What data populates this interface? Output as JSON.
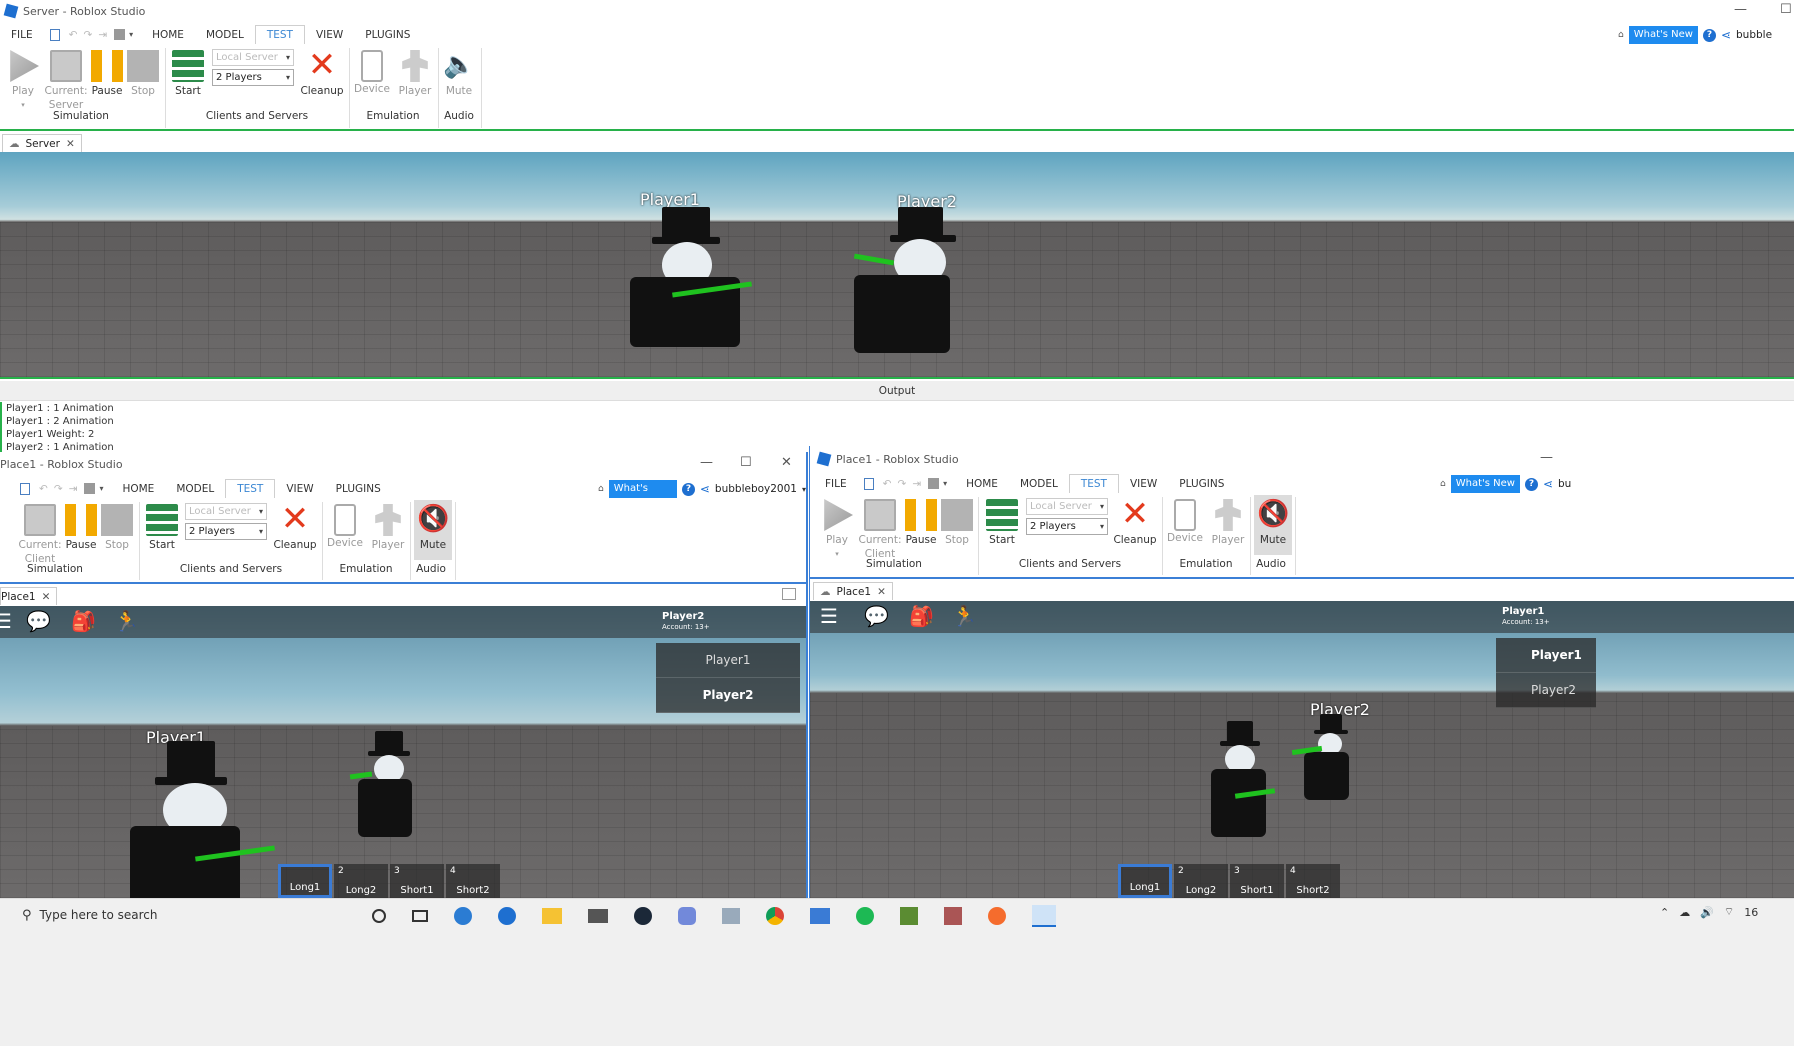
{
  "server": {
    "title": "Server - Roblox Studio",
    "menu": [
      "FILE",
      "HOME",
      "MODEL",
      "TEST",
      "VIEW",
      "PLUGINS"
    ],
    "whats_new": "What's New",
    "user": "bubble",
    "tools": {
      "play": "Play",
      "current": "Current:\nServer",
      "pause": "Pause",
      "stop": "Stop",
      "start": "Start",
      "local_server": "Local Server",
      "players": "2 Players",
      "cleanup": "Cleanup",
      "device": "Device",
      "player": "Player",
      "mute": "Mute"
    },
    "groups": {
      "simulation": "Simulation",
      "clients": "Clients and Servers",
      "emulation": "Emulation",
      "audio": "Audio"
    },
    "doc_tab": "Server",
    "tag1": "Player1",
    "tag2": "Player2"
  },
  "output": {
    "title": "Output",
    "lines": [
      "Player1 : 1 Animation",
      "Player1 : 2 Animation",
      "Player1 Weight: 2",
      "Player2 : 1 Animation"
    ]
  },
  "place_left": {
    "title": "Place1 - Roblox Studio",
    "menu": [
      "HOME",
      "MODEL",
      "TEST",
      "VIEW",
      "PLUGINS"
    ],
    "whats_new": "What's New",
    "user": "bubbleboy2001",
    "tools": {
      "current": "Current:\nClient",
      "pause": "Pause",
      "stop": "Stop",
      "start": "Start",
      "local_server": "Local Server",
      "players": "2 Players",
      "cleanup": "Cleanup",
      "device": "Device",
      "player": "Player",
      "mute": "Mute"
    },
    "groups": {
      "simulation": "Simulation",
      "clients": "Clients and Servers",
      "emulation": "Emulation",
      "audio": "Audio"
    },
    "doc_tab": "Place1",
    "hud_name": "Player2",
    "hud_account": "Account: 13+",
    "list": [
      "Player1",
      "Player2"
    ],
    "tag": "Player1",
    "slots": [
      {
        "n": "",
        "l": "Long1"
      },
      {
        "n": "2",
        "l": "Long2"
      },
      {
        "n": "3",
        "l": "Short1"
      },
      {
        "n": "4",
        "l": "Short2"
      }
    ]
  },
  "place_right": {
    "title": "Place1 - Roblox Studio",
    "menu": [
      "FILE",
      "HOME",
      "MODEL",
      "TEST",
      "VIEW",
      "PLUGINS"
    ],
    "whats_new": "What's New",
    "user": "bu",
    "tools": {
      "play": "Play",
      "current": "Current:\nClient",
      "pause": "Pause",
      "stop": "Stop",
      "start": "Start",
      "local_server": "Local Server",
      "players": "2 Players",
      "cleanup": "Cleanup",
      "device": "Device",
      "player": "Player",
      "mute": "Mute"
    },
    "groups": {
      "simulation": "Simulation",
      "clients": "Clients and Servers",
      "emulation": "Emulation",
      "audio": "Audio"
    },
    "doc_tab": "Place1",
    "hud_name": "Player1",
    "hud_account": "Account: 13+",
    "list": [
      "Player1",
      "Player2"
    ],
    "tag": "Player2",
    "slots": [
      {
        "n": "",
        "l": "Long1"
      },
      {
        "n": "2",
        "l": "Long2"
      },
      {
        "n": "3",
        "l": "Short1"
      },
      {
        "n": "4",
        "l": "Short2"
      }
    ]
  },
  "taskbar": {
    "search_placeholder": "Type here to search",
    "time": "16"
  }
}
